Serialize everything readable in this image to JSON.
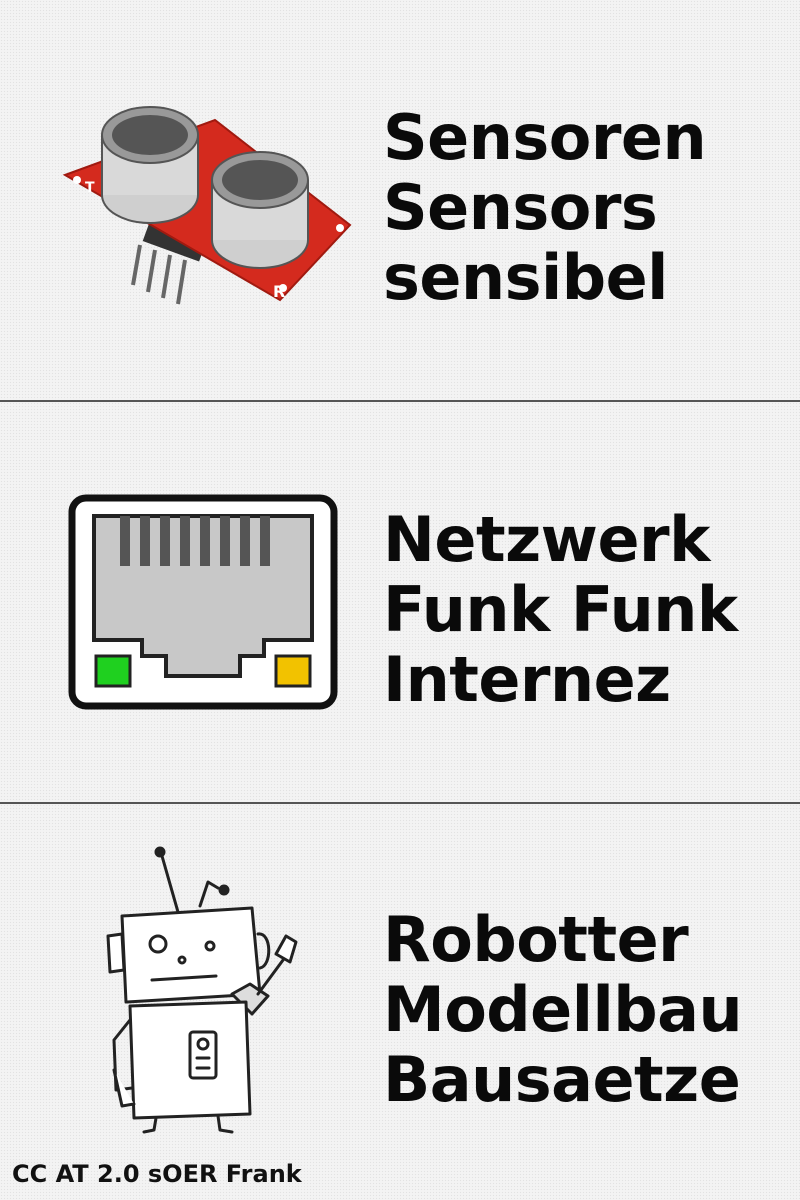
{
  "sections": [
    {
      "lines": [
        "Sensoren",
        "Sensors",
        "sensibel"
      ],
      "illustration": "ultrasonic-sensor-icon"
    },
    {
      "lines": [
        "Netzwerk",
        "Funk Funk",
        "Internez"
      ],
      "illustration": "ethernet-port-icon"
    },
    {
      "lines": [
        "Robotter",
        "Modellbau",
        "Bausaetze"
      ],
      "illustration": "robot-icon"
    }
  ],
  "credit": "CC AT 2.0 sOER Frank",
  "colors": {
    "pcb_red": "#d42a1e",
    "led_green": "#1fd01f",
    "led_yellow": "#f2c200",
    "text": "#0a0a0a"
  }
}
